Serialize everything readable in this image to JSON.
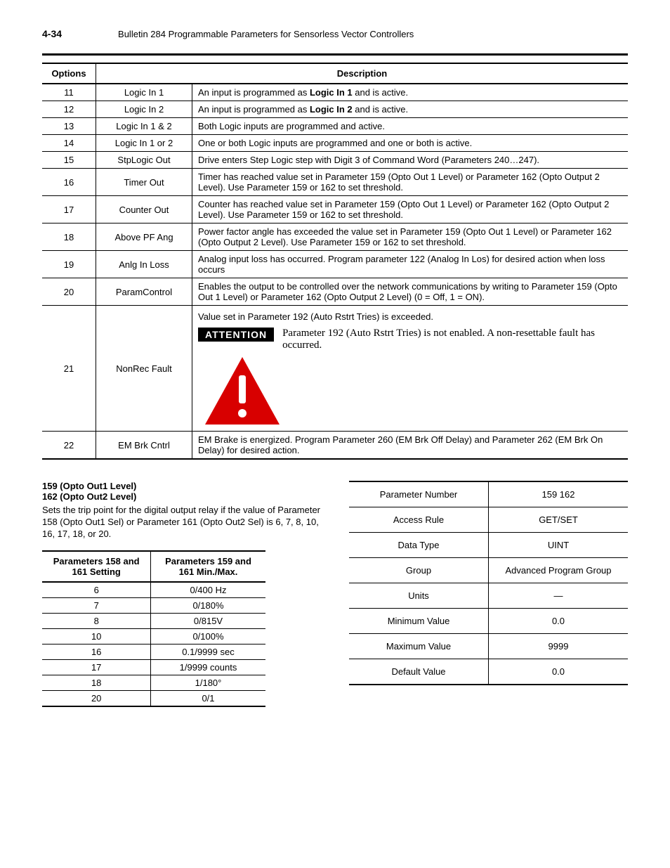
{
  "header": {
    "page_num": "4-34",
    "title": "Bulletin 284 Programmable Parameters for Sensorless Vector Controllers"
  },
  "options_table": {
    "headers": {
      "options": "Options",
      "description": "Description"
    },
    "rows": [
      {
        "opt": "11",
        "name": "Logic In 1",
        "desc_pre": "An input is programmed as ",
        "desc_bold": "Logic In 1",
        "desc_post": " and is active."
      },
      {
        "opt": "12",
        "name": "Logic In 2",
        "desc_pre": "An input is programmed as ",
        "desc_bold": "Logic In 2",
        "desc_post": " and is active."
      },
      {
        "opt": "13",
        "name": "Logic In 1 & 2",
        "desc": "Both Logic inputs are programmed and active."
      },
      {
        "opt": "14",
        "name": "Logic In 1 or 2",
        "desc": "One or both Logic inputs are programmed and one or both is active."
      },
      {
        "opt": "15",
        "name": "StpLogic Out",
        "desc": "Drive enters Step Logic step with Digit 3 of Command Word (Parameters 240…247)."
      },
      {
        "opt": "16",
        "name": "Timer Out",
        "desc": "Timer has reached value set in Parameter 159 (Opto Out 1 Level) or Parameter 162 (Opto Output 2 Level). Use Parameter 159 or 162 to set threshold."
      },
      {
        "opt": "17",
        "name": "Counter Out",
        "desc": "Counter has reached value set in Parameter 159 (Opto Out 1 Level) or Parameter 162 (Opto Output 2 Level). Use Parameter 159 or 162 to set threshold."
      },
      {
        "opt": "18",
        "name": "Above PF Ang",
        "desc": "Power factor angle has exceeded the value set in Parameter 159 (Opto Out 1 Level) or Parameter 162 (Opto Output 2 Level). Use Parameter 159 or 162 to set threshold."
      },
      {
        "opt": "19",
        "name": "Anlg In Loss",
        "desc": "Analog input loss has occurred. Program parameter 122 (Analog In Los) for desired action when loss occurs"
      },
      {
        "opt": "20",
        "name": "ParamControl",
        "desc": "Enables the output to be controlled over the network communications by writing to Parameter 159 (Opto Out 1 Level) or Parameter 162 (Opto Output 2 Level) (0 = Off, 1 = ON)."
      },
      {
        "opt": "21",
        "name": "NonRec Fault",
        "desc_top": "Value set in Parameter 192 (Auto Rstrt Tries) is exceeded.",
        "attention_label": "ATTENTION",
        "attention_msg": "Parameter 192 (Auto Rstrt Tries) is not enabled. A non-resettable fault has occurred."
      },
      {
        "opt": "22",
        "name": "EM Brk Cntrl",
        "desc": "EM Brake is energized. Program Parameter 260 (EM Brk Off Delay) and Parameter 262 (EM Brk On Delay) for desired action."
      }
    ]
  },
  "param_block": {
    "title1": "159 (Opto Out1 Level)",
    "title2": "162 (Opto Out2 Level)",
    "desc": "Sets the trip point for the digital output relay if the value of Parameter 158 (Opto Out1 Sel) or Parameter 161 (Opto Out2 Sel) is 6, 7, 8, 10, 16, 17, 18, or 20."
  },
  "settings_table": {
    "headers": {
      "setting": "Parameters 158 and 161 Setting",
      "minmax": "Parameters 159 and 161 Min./Max."
    },
    "rows": [
      {
        "setting": "6",
        "minmax": "0/400 Hz"
      },
      {
        "setting": "7",
        "minmax": "0/180%"
      },
      {
        "setting": "8",
        "minmax": "0/815V"
      },
      {
        "setting": "10",
        "minmax": "0/100%"
      },
      {
        "setting": "16",
        "minmax": "0.1/9999 sec"
      },
      {
        "setting": "17",
        "minmax": "1/9999 counts"
      },
      {
        "setting": "18",
        "minmax": "1/180°"
      },
      {
        "setting": "20",
        "minmax": "0/1"
      }
    ]
  },
  "props_table": {
    "rows": [
      {
        "label": "Parameter Number",
        "value": "159 162"
      },
      {
        "label": "Access Rule",
        "value": "GET/SET"
      },
      {
        "label": "Data Type",
        "value": "UINT"
      },
      {
        "label": "Group",
        "value": "Advanced Program Group"
      },
      {
        "label": "Units",
        "value": "—"
      },
      {
        "label": "Minimum Value",
        "value": "0.0"
      },
      {
        "label": "Maximum Value",
        "value": "9999"
      },
      {
        "label": "Default Value",
        "value": "0.0"
      }
    ]
  }
}
